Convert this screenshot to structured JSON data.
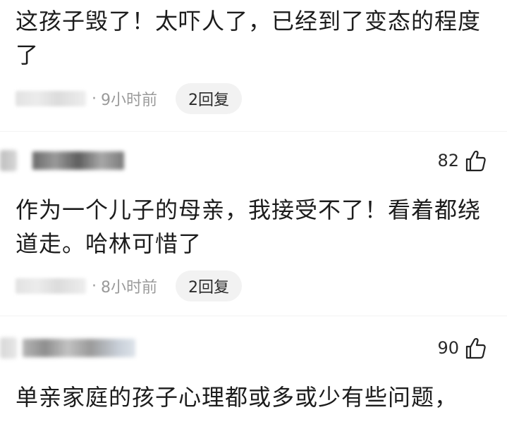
{
  "comments": [
    {
      "text": "这孩子毁了！太吓人了，已经到了变态的程度了",
      "time": "9小时前",
      "replies": "2回复"
    },
    {
      "likes": "82",
      "text": "作为一个儿子的母亲，我接受不了！看着都绕道走。哈林可惜了",
      "time": "8小时前",
      "replies": "2回复"
    },
    {
      "likes": "90",
      "text": "单亲家庭的孩子心理都或多或少有些问题，"
    }
  ],
  "icons": {
    "like": "thumbs-up-icon"
  },
  "colors": {
    "meta_text": "#9a9a9a",
    "pill_bg": "#f2f2f2",
    "text": "#1c1c1c"
  }
}
